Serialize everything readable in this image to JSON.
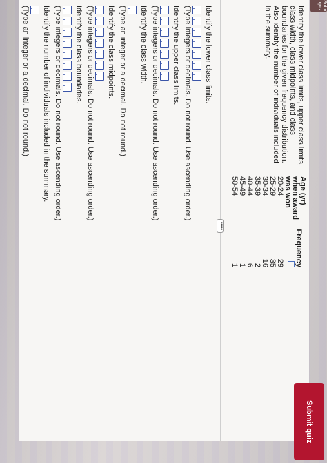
{
  "top_tab": "Submit quiz",
  "intro_text": "Identify the lower class limits, upper class limits, class width, class midpoints, and class boundaries for the given frequency distribution. Also identify the number of individuals included in the summary.",
  "table": {
    "col1_header": "Age (yr) when award was won",
    "col2_header": "Frequency",
    "rows": [
      {
        "age": "20-24",
        "freq": "29"
      },
      {
        "age": "25-29",
        "freq": "35"
      },
      {
        "age": "30-34",
        "freq": "16"
      },
      {
        "age": "35-39",
        "freq": "2"
      },
      {
        "age": "40-44",
        "freq": "6"
      },
      {
        "age": "45-49",
        "freq": "1"
      },
      {
        "age": "50-54",
        "freq": "1"
      }
    ]
  },
  "more_label": "•••••",
  "q1": {
    "label": "Identify the lower class limits.",
    "hint": "(Type integers or decimals. Do not round. Use ascending order.)"
  },
  "q2": {
    "label": "Identify the upper class limits.",
    "hint": "(Type integers or decimals. Do not round. Use ascending order.)"
  },
  "q3": {
    "label": "Identify the class width.",
    "hint": "(Type an integer or a decimal. Do not round.)"
  },
  "q4": {
    "label": "Identify the class midpoints.",
    "hint": "(Type integers or decimals. Do not round. Use ascending order.)"
  },
  "q5": {
    "label": "Identify the class boundaries.",
    "hint": "(Type integers or decimals. Do not round. Use ascending order.)"
  },
  "q6": {
    "label": "Identify the number of individuals included in the summary.",
    "hint": "(Type an integer or a decimal. Do not round.)"
  },
  "submit_label": "Submit quiz"
}
